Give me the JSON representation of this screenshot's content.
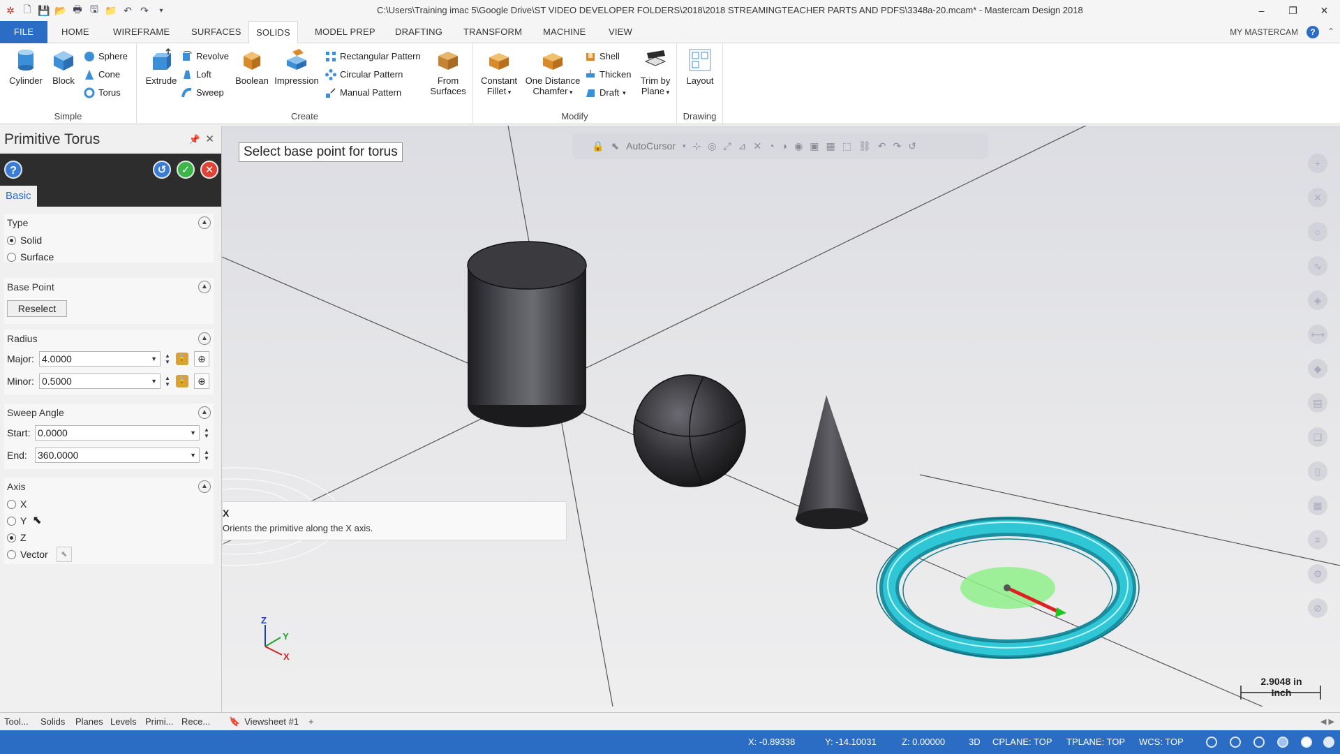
{
  "window": {
    "title": "C:\\Users\\Training imac 5\\Google Drive\\ST VIDEO DEVELOPER FOLDERS\\2018\\2018 STREAMINGTEACHER PARTS AND PDFS\\3348a-20.mcam* - Mastercam Design 2018"
  },
  "menu": {
    "tabs": [
      "FILE",
      "HOME",
      "WIREFRAME",
      "SURFACES",
      "SOLIDS",
      "MODEL PREP",
      "DRAFTING",
      "TRANSFORM",
      "MACHINE",
      "VIEW"
    ],
    "active": "SOLIDS",
    "my_mastercam": "MY MASTERCAM"
  },
  "ribbon": {
    "simple": {
      "label": "Simple",
      "cylinder": "Cylinder",
      "block": "Block",
      "sphere": "Sphere",
      "cone": "Cone",
      "torus": "Torus"
    },
    "create": {
      "label": "Create",
      "extrude": "Extrude",
      "revolve": "Revolve",
      "loft": "Loft",
      "sweep": "Sweep",
      "boolean": "Boolean",
      "impression": "Impression",
      "rect_pattern": "Rectangular Pattern",
      "circ_pattern": "Circular Pattern",
      "manual_pattern": "Manual Pattern",
      "from_surfaces_1": "From",
      "from_surfaces_2": "Surfaces"
    },
    "modify": {
      "label": "Modify",
      "const_fillet_1": "Constant",
      "const_fillet_2": "Fillet",
      "chamfer_1": "One Distance",
      "chamfer_2": "Chamfer",
      "shell": "Shell",
      "thicken": "Thicken",
      "draft": "Draft",
      "trim_1": "Trim by",
      "trim_2": "Plane"
    },
    "drawing": {
      "label": "Drawing",
      "layout": "Layout"
    }
  },
  "panel": {
    "title": "Primitive Torus",
    "tab": "Basic",
    "type": {
      "label": "Type",
      "options": [
        "Solid",
        "Surface"
      ],
      "selected": "Solid"
    },
    "base_point": {
      "label": "Base Point",
      "reselect": "Reselect"
    },
    "radius": {
      "label": "Radius",
      "major_label": "Major:",
      "major": "4.0000",
      "minor_label": "Minor:",
      "minor": "0.5000"
    },
    "sweep": {
      "label": "Sweep Angle",
      "start_label": "Start:",
      "start": "0.0000",
      "end_label": "End:",
      "end": "360.0000"
    },
    "axis": {
      "label": "Axis",
      "options": [
        "X",
        "Y",
        "Z",
        "Vector"
      ],
      "selected": "Z"
    }
  },
  "viewport": {
    "prompt": "Select base point for torus",
    "autocursor": "AutoCursor",
    "tooltip_title": "X",
    "tooltip_desc": "Orients the primitive along the X axis.",
    "scale_value": "2.9048 in",
    "scale_unit": "Inch",
    "axis_labels": {
      "z": "Z",
      "y": "Y",
      "x": "X"
    }
  },
  "bottom_tabs": [
    "Tool...",
    "Solids",
    "Planes",
    "Levels",
    "Primi...",
    "Rece..."
  ],
  "viewsheet": "Viewsheet #1",
  "status": {
    "x": "X:  -0.89338",
    "y": "Y:  -14.10031",
    "z": "Z:  0.00000",
    "mode": "3D",
    "cplane": "CPLANE: TOP",
    "tplane": "TPLANE: TOP",
    "wcs": "WCS: TOP"
  },
  "colors": {
    "accent": "#2b6cc4",
    "torus": "#2fc6d6",
    "panel_dark": "#2d2d2d"
  }
}
